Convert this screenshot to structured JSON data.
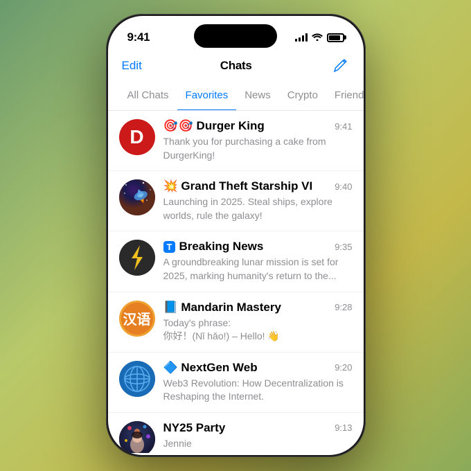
{
  "statusBar": {
    "time": "9:41"
  },
  "header": {
    "editLabel": "Edit",
    "title": "Chats"
  },
  "tabs": [
    {
      "id": "all-chats",
      "label": "All Chats",
      "active": false
    },
    {
      "id": "favorites",
      "label": "Favorites",
      "active": true
    },
    {
      "id": "news",
      "label": "News",
      "active": false
    },
    {
      "id": "crypto",
      "label": "Crypto",
      "active": false
    },
    {
      "id": "friends",
      "label": "Friends",
      "active": false
    }
  ],
  "chats": [
    {
      "id": "durger-king",
      "name": "🎯 Durger King",
      "preview": "Thank you for purchasing a cake from DurgerKing!",
      "time": "9:41",
      "avatarType": "letter",
      "avatarLetter": "D",
      "avatarBg": "#cc1a1a"
    },
    {
      "id": "grand-theft-starship",
      "name": "💥 Grand Theft Starship VI",
      "preview": "Launching in 2025. Steal ships, explore worlds, rule the galaxy!",
      "time": "9:40",
      "avatarType": "starship",
      "avatarBg": "#1a1a3e"
    },
    {
      "id": "breaking-news",
      "name": "🅃 Breaking News",
      "preview": "A groundbreaking lunar mission is set for 2025, marking humanity's return to the...",
      "time": "9:35",
      "avatarType": "lightning",
      "avatarBg": "#2a2a2a"
    },
    {
      "id": "mandarin-mastery",
      "name": "📘 Mandarin Mastery",
      "preview": "Today's phrase:\n你好！(Nǐ hǎo!) – Hello! 👋",
      "time": "9:28",
      "avatarType": "chinese",
      "avatarBg": "#e67e22"
    },
    {
      "id": "nextgen-web",
      "name": "🔷 NextGen Web",
      "preview": "Web3 Revolution: How Decentralization is Reshaping the Internet.",
      "time": "9:20",
      "avatarType": "globe",
      "avatarBg": "#1a6bb5"
    },
    {
      "id": "ny25-party",
      "name": "NY25 Party",
      "preview": "Jennie",
      "time": "9:13",
      "avatarType": "party",
      "avatarBg": "#1a2a4a"
    }
  ]
}
